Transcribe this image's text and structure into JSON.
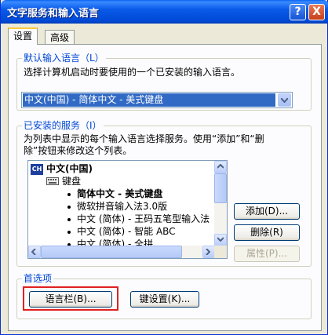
{
  "window": {
    "title": "文字服务和输入语言",
    "help_glyph": "?",
    "close_glyph": "X"
  },
  "tabs": [
    {
      "label": "设置",
      "active": true
    },
    {
      "label": "高级",
      "active": false
    }
  ],
  "default_language": {
    "group_label": "默认输入语言（L）",
    "description": "选择计算机启动时要使用的一个已安装的输入语言。",
    "selected_value": "中文(中国) - 简体中文 - 美式键盘"
  },
  "installed_services": {
    "group_label": "已安装的服务（I）",
    "description_line1": "为列表中显示的每个输入语言选择服务。使用“添加”和“删",
    "description_line2": "除”按钮来修改这个列表。",
    "tree": {
      "language_badge": "CH",
      "language": "中文(中国)",
      "category": "键盘",
      "items": [
        {
          "label": "简体中文 - 美式键盘",
          "bold": true
        },
        {
          "label": "微软拼音输入法3.0版",
          "bold": false
        },
        {
          "label": "中文 (简体) - 王码五笔型输入法",
          "bold": false
        },
        {
          "label": "中文 (简体) - 智能 ABC",
          "bold": false
        },
        {
          "label": "中文 (简体) - 全拼",
          "bold": false
        }
      ]
    },
    "buttons": {
      "add": "添加(D)...",
      "remove": "删除(R)",
      "properties": "属性(P)..."
    }
  },
  "preferences": {
    "group_label": "首选项",
    "language_bar_button": "语言栏(B)...",
    "key_settings_button": "键设置(K)..."
  },
  "colors": {
    "title_bar": "#0A5AE8",
    "group_label": "#0046D5",
    "selection": "#316AC5",
    "highlight_box": "#E02020"
  }
}
